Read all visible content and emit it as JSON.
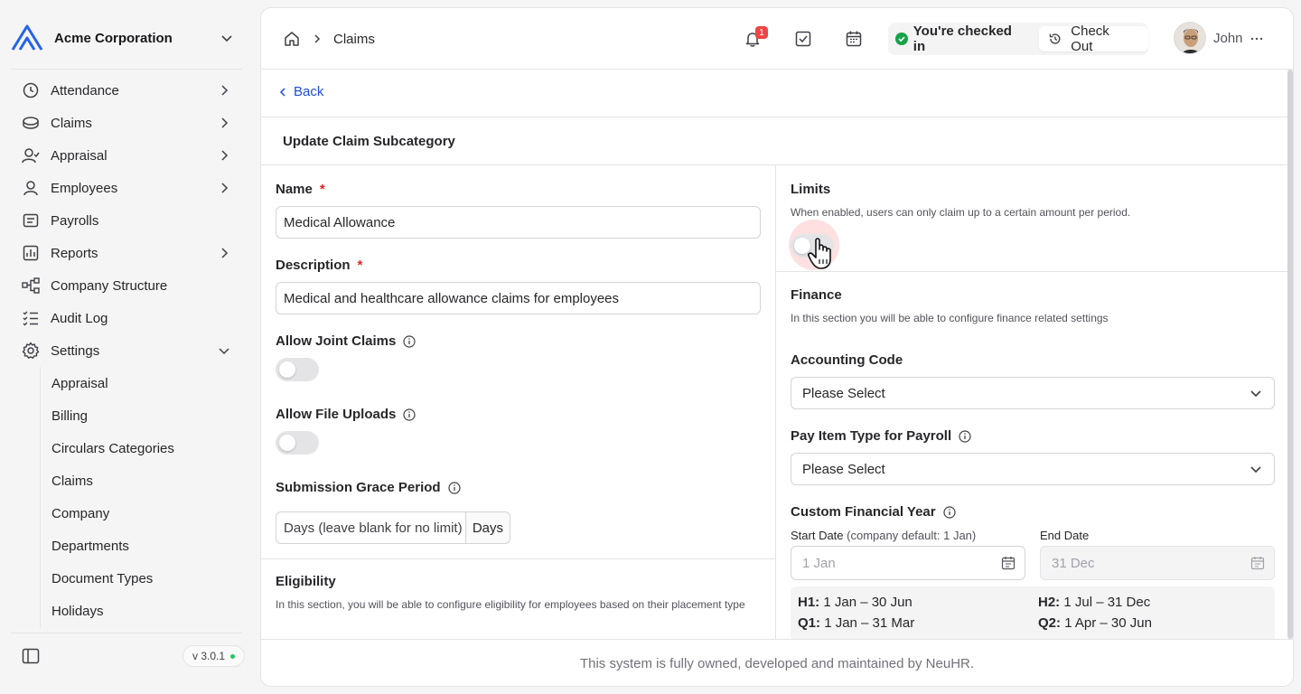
{
  "sidebar": {
    "org_name": "Acme Corporation",
    "items": [
      {
        "label": "Attendance",
        "icon": "clock-icon"
      },
      {
        "label": "Claims",
        "icon": "coins-icon"
      },
      {
        "label": "Appraisal",
        "icon": "user-check-icon"
      },
      {
        "label": "Employees",
        "icon": "user-icon"
      },
      {
        "label": "Payrolls",
        "icon": "banknote-icon"
      },
      {
        "label": "Reports",
        "icon": "chart-icon"
      },
      {
        "label": "Company Structure",
        "icon": "org-chart-icon"
      },
      {
        "label": "Audit Log",
        "icon": "list-check-icon"
      },
      {
        "label": "Settings",
        "icon": "gear-icon"
      }
    ],
    "settings_sub": [
      "Appraisal",
      "Billing",
      "Circulars Categories",
      "Claims",
      "Company",
      "Departments",
      "Document Types",
      "Holidays"
    ],
    "version": "v 3.0.1"
  },
  "topbar": {
    "breadcrumb": "Claims",
    "notification_count": "1",
    "checkin_status": "You're checked in",
    "checkout_label": "Check Out",
    "user_name": "John"
  },
  "page": {
    "back_label": "Back",
    "title": "Update Claim Subcategory"
  },
  "form": {
    "name_label": "Name",
    "name_value": "Medical Allowance",
    "description_label": "Description",
    "description_value": "Medical and healthcare allowance claims for employees",
    "joint_claims_label": "Allow Joint Claims",
    "file_uploads_label": "Allow File Uploads",
    "grace_label": "Submission Grace Period",
    "grace_placeholder": "Days (leave blank for no limit)",
    "grace_unit": "Days",
    "eligibility_title": "Eligibility",
    "eligibility_help": "In this section, you will be able to configure eligibility for employees based on their placement type",
    "required_mark": "*"
  },
  "right": {
    "limits_title": "Limits",
    "limits_help": "When enabled, users can only claim up to a certain amount per period.",
    "finance_title": "Finance",
    "finance_help": "In this section you will be able to configure finance related settings",
    "accounting_label": "Accounting Code",
    "accounting_value": "Please Select",
    "pay_item_label": "Pay Item Type for Payroll",
    "pay_item_value": "Please Select",
    "cfy_label": "Custom Financial Year",
    "start_label": "Start Date",
    "start_hint": "(company default: 1 Jan)",
    "start_placeholder": "1 Jan",
    "end_label": "End Date",
    "end_placeholder": "31 Dec",
    "presets": [
      {
        "key": "H1:",
        "value": "1 Jan – 30 Jun"
      },
      {
        "key": "H2:",
        "value": "1 Jul – 31 Dec"
      },
      {
        "key": "Q1:",
        "value": "1 Jan – 31 Mar"
      },
      {
        "key": "Q2:",
        "value": "1 Apr – 30 Jun"
      }
    ]
  },
  "footer": {
    "text": "This system is fully owned, developed and maintained by NeuHR."
  },
  "colors": {
    "accent": "#1d4ed8",
    "required": "#dc2626",
    "badge": "#ef4444",
    "success": "#16a34a"
  }
}
